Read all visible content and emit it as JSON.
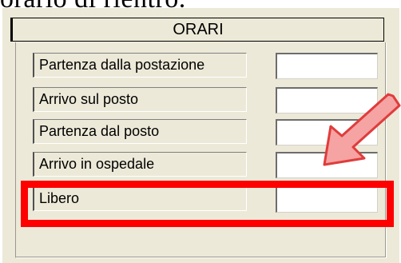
{
  "top_caption": "orario di rientro.",
  "panel": {
    "header": "ORARI",
    "rows": [
      {
        "label": "Partenza dalla postazione",
        "value": ""
      },
      {
        "label": "Arrivo sul posto",
        "value": ""
      },
      {
        "label": "Partenza dal posto",
        "value": ""
      },
      {
        "label": "Arrivo in ospedale",
        "value": ""
      },
      {
        "label": "Libero",
        "value": ""
      }
    ]
  },
  "annotations": {
    "highlight_color": "#ff0000",
    "arrow_fill": "#f5a3a3",
    "arrow_stroke": "#e03c3c",
    "arrow_icon": "pointer-arrow-icon",
    "highlighted_row": "Libero"
  }
}
